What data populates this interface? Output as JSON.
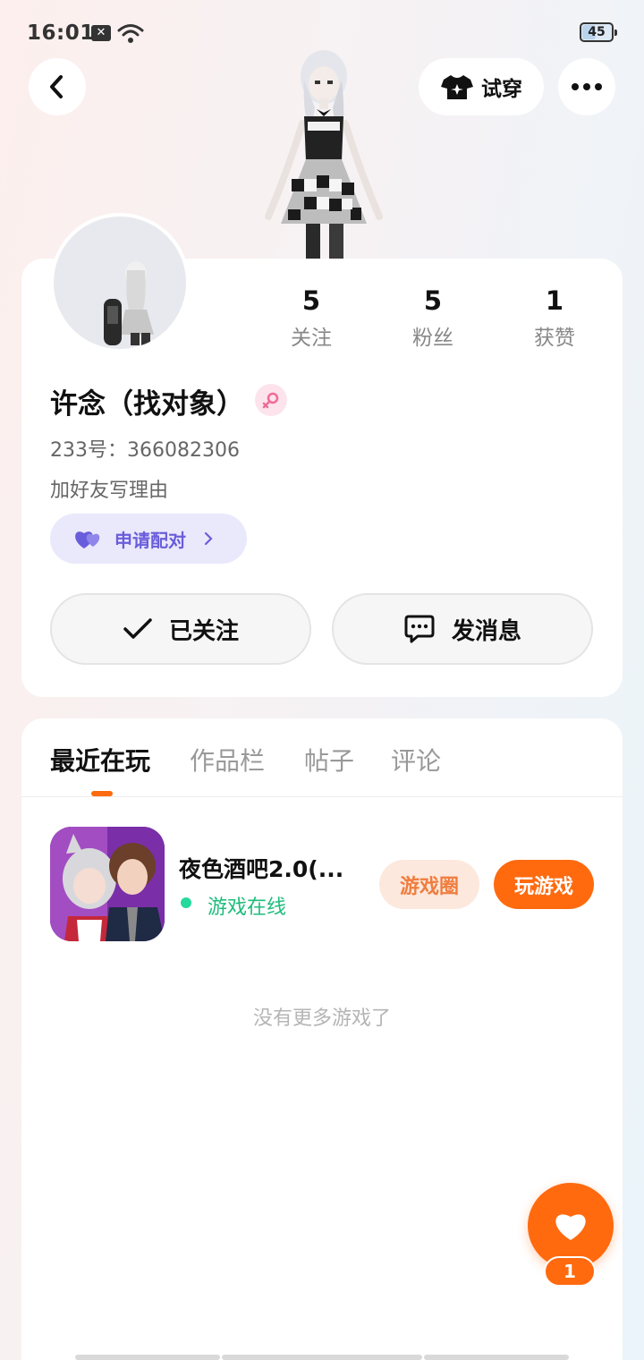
{
  "status_bar": {
    "time": "16:01",
    "notif_icon": "x-icon",
    "battery": "45",
    "battery_level": 0.45
  },
  "header": {
    "tryon_label": "试穿"
  },
  "profile": {
    "stats": [
      {
        "value": "5",
        "label": "关注"
      },
      {
        "value": "5",
        "label": "粉丝"
      },
      {
        "value": "1",
        "label": "获赞"
      }
    ],
    "username": "许念（找对象）",
    "account_id": "233号：366082306",
    "add_reason": "加好友写理由",
    "pair_label": "申请配对",
    "follow_label": "已关注",
    "message_label": "发消息"
  },
  "tabs": [
    "最近在玩",
    "作品栏",
    "帖子",
    "评论"
  ],
  "game": {
    "title": "夜色酒吧2.0(...",
    "status": "游戏在线",
    "circle_label": "游戏圈",
    "play_label": "玩游戏"
  },
  "no_more_text": "没有更多游戏了",
  "fab": {
    "badge": "1"
  },
  "colors": {
    "accent": "#ff6a0f",
    "online": "#1ebd7c",
    "pair": "#6a5ddb"
  }
}
